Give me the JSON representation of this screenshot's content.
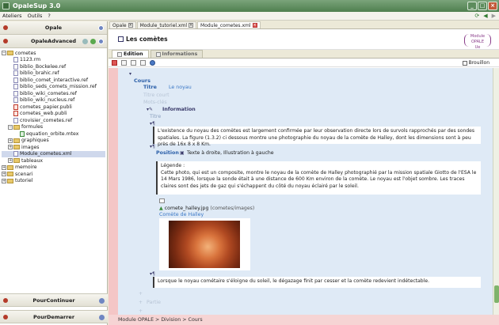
{
  "window": {
    "title": "OpaleSup 3.0"
  },
  "menu": {
    "items": [
      "Ateliers",
      "Outils",
      "?"
    ]
  },
  "left_panel": {
    "top_header": "Opale",
    "second_header": "OpaleAdvanced",
    "tree": [
      {
        "label": "cometes",
        "depth": 0,
        "kind": "folder",
        "expanded": true
      },
      {
        "label": "1123.rm",
        "depth": 1,
        "kind": "file"
      },
      {
        "label": "biblio_Bockelee.ref",
        "depth": 1,
        "kind": "file"
      },
      {
        "label": "biblio_brahic.ref",
        "depth": 1,
        "kind": "file"
      },
      {
        "label": "biblio_comet_interactive.ref",
        "depth": 1,
        "kind": "file"
      },
      {
        "label": "biblio_seds_comets_mission.ref",
        "depth": 1,
        "kind": "file"
      },
      {
        "label": "biblio_wiki_cometes.ref",
        "depth": 1,
        "kind": "file"
      },
      {
        "label": "biblio_wiki_nucleus.ref",
        "depth": 1,
        "kind": "file"
      },
      {
        "label": "cometes_papier.publi",
        "depth": 1,
        "kind": "file-red"
      },
      {
        "label": "cometes_web.publi",
        "depth": 1,
        "kind": "file-red"
      },
      {
        "label": "crovisier_cometes.ref",
        "depth": 1,
        "kind": "file"
      },
      {
        "label": "formules",
        "depth": 1,
        "kind": "folder",
        "expanded": true
      },
      {
        "label": "equation_orbite.mtex",
        "depth": 2,
        "kind": "file-grn"
      },
      {
        "label": "graphiques",
        "depth": 1,
        "kind": "folder",
        "expanded": false
      },
      {
        "label": "images",
        "depth": 1,
        "kind": "folder",
        "expanded": false
      },
      {
        "label": "Module_cometes.xml",
        "depth": 1,
        "kind": "file",
        "selected": true
      },
      {
        "label": "tableaux",
        "depth": 1,
        "kind": "folder",
        "expanded": false
      },
      {
        "label": "memoire",
        "depth": 0,
        "kind": "folder",
        "expanded": false
      },
      {
        "label": "scenari",
        "depth": 0,
        "kind": "folder",
        "expanded": false
      },
      {
        "label": "tutoriel",
        "depth": 0,
        "kind": "folder",
        "expanded": false
      }
    ],
    "bottom_headers": [
      "PourContinuer",
      "PourDemarrer"
    ]
  },
  "tabs": [
    {
      "label": "Opale",
      "active": false
    },
    {
      "label": "Module_tutoriel.xml",
      "active": false
    },
    {
      "label": "Module_cometes.xml",
      "active": true
    }
  ],
  "doc": {
    "title": "Les comètes",
    "badge_line1": "Module OPALE",
    "badge_line2": "Ue",
    "subtabs": [
      "Edition",
      "Informations"
    ],
    "brouillon_label": "Brouillon"
  },
  "editor": {
    "cours_label": "Cours",
    "titre_label": "Titre",
    "titre_value": "Le noyau",
    "titre_court_label": "Titre court",
    "mots_cles_label": "Mots-clés",
    "information_label": "Information",
    "titre2_label": "Titre",
    "para1": "L'existence du noyau des comètes est largement confirmée par leur observation directe lors de survols rapprochés par des sondes spatiales. La figure (1.3.2) ci dessous montre une photographie du noyau de la comète de Halley, dont les dimensions sont à peu près de 16x 8 x 8 Km.",
    "position_label": "Position",
    "position_value": "Texte à droite, Illustration à gauche",
    "legende_label": "Légende :",
    "legende_text": "Cette photo, qui est un composite, montre le noyau de la comète de Halley photographié par la mission spatiale Giotto de l'ESA le 14 Mars 1986, lorsque la sonde était à une distance de 600 Km environ de la comète. Le noyau est l'objet sombre. Les traces claires sont des jets de gaz qui s'échappent du côté du noyau éclairé par le soleil.",
    "image_file": "comete_halley.jpg",
    "image_path": "(cometes/images)",
    "image_caption": "Comète de Halley",
    "para2": "Lorsque le noyau cométaire s'éloigne du soleil, le dégazage finit par cesser et la comète redevient indétectable.",
    "partie_label": "Partie"
  },
  "breadcrumb": "Module OPALE > Division > Cours",
  "colors": {
    "titlebar": "#5b8b5b",
    "editor_bg": "#dfeaf6",
    "margin_red": "#f4c6c6",
    "label_blue": "#3b78c6"
  }
}
